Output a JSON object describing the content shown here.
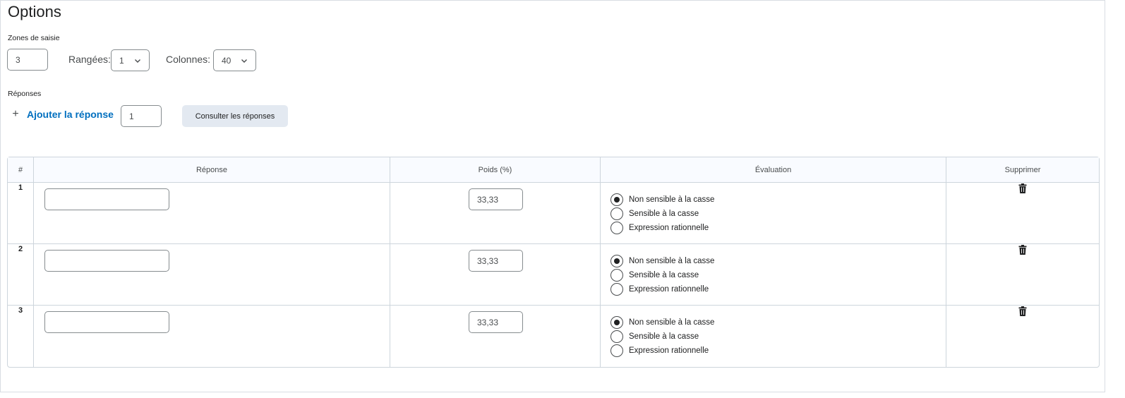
{
  "title": "Options",
  "input_zones": {
    "label": "Zones de saisie",
    "value": "3",
    "rows_label": "Rangées:",
    "rows_value": "1",
    "columns_label": "Colonnes:",
    "columns_value": "40"
  },
  "answers": {
    "label": "Réponses",
    "add_label": "Ajouter la réponse",
    "add_count": "1",
    "view_button": "Consulter les réponses"
  },
  "table": {
    "headers": [
      "#",
      "Réponse",
      "Poids (%)",
      "Évaluation",
      "Supprimer"
    ],
    "rows": [
      {
        "num": "1",
        "answer": "",
        "weight": "33,33",
        "options": [
          "Non sensible à la casse",
          "Sensible à la casse",
          "Expression rationnelle"
        ],
        "selected": 0
      },
      {
        "num": "2",
        "answer": "",
        "weight": "33,33",
        "options": [
          "Non sensible à la casse",
          "Sensible à la casse",
          "Expression rationnelle"
        ],
        "selected": 0
      },
      {
        "num": "3",
        "answer": "",
        "weight": "33,33",
        "options": [
          "Non sensible à la casse",
          "Sensible à la casse",
          "Expression rationnelle"
        ],
        "selected": 0
      }
    ]
  },
  "icons": {
    "add": "plus-icon",
    "select": "chevron-down-icon",
    "delete": "trash-icon"
  },
  "colors": {
    "link": "#006fbf",
    "button_bg": "#e3e9f1",
    "header_bg": "#f9fbff"
  }
}
